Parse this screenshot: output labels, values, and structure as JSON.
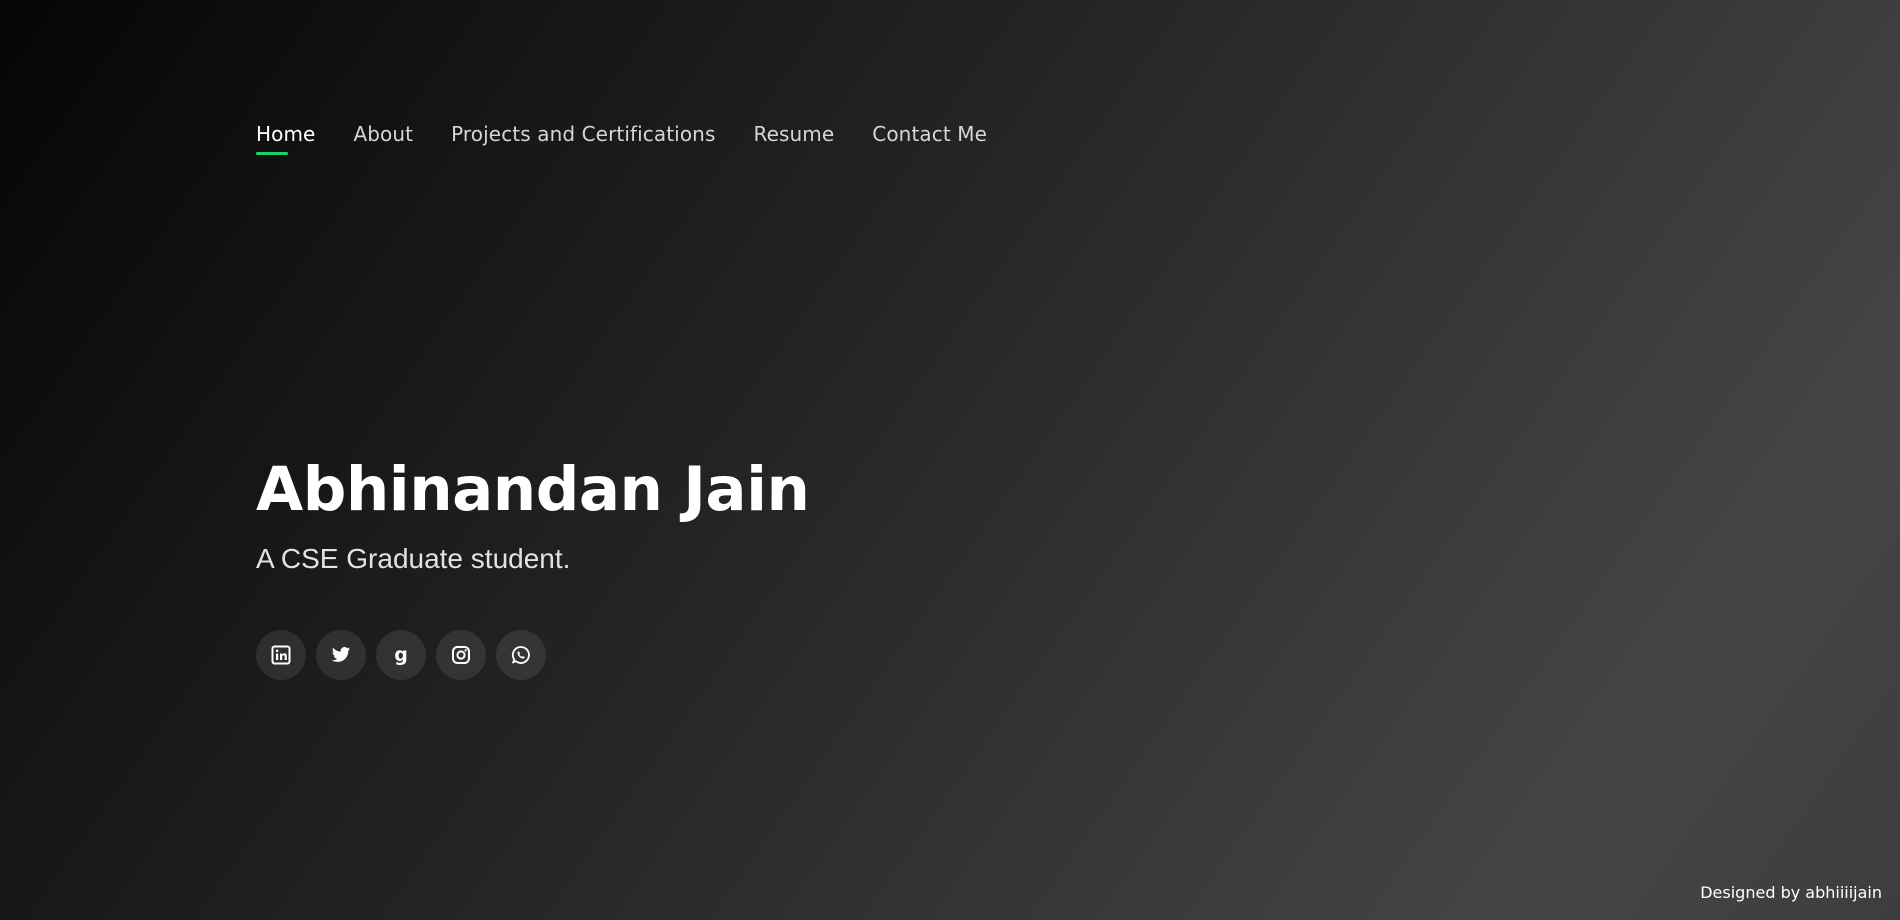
{
  "nav": {
    "items": [
      {
        "label": "Home",
        "active": true
      },
      {
        "label": "About"
      },
      {
        "label": "Projects and Certifications"
      },
      {
        "label": "Resume"
      },
      {
        "label": "Contact Me"
      }
    ],
    "active_indicator_color": "#18d26e"
  },
  "hero": {
    "name": "Abhinandan Jain",
    "tagline": "A CSE Graduate student."
  },
  "social": {
    "links": [
      {
        "icon": "linkedin-icon"
      },
      {
        "icon": "twitter-icon"
      },
      {
        "icon": "goodreads-icon",
        "glyph": "g"
      },
      {
        "icon": "instagram-icon"
      },
      {
        "icon": "whatsapp-icon"
      }
    ]
  },
  "footer": {
    "credit": "Designed by abhiiiijain"
  }
}
